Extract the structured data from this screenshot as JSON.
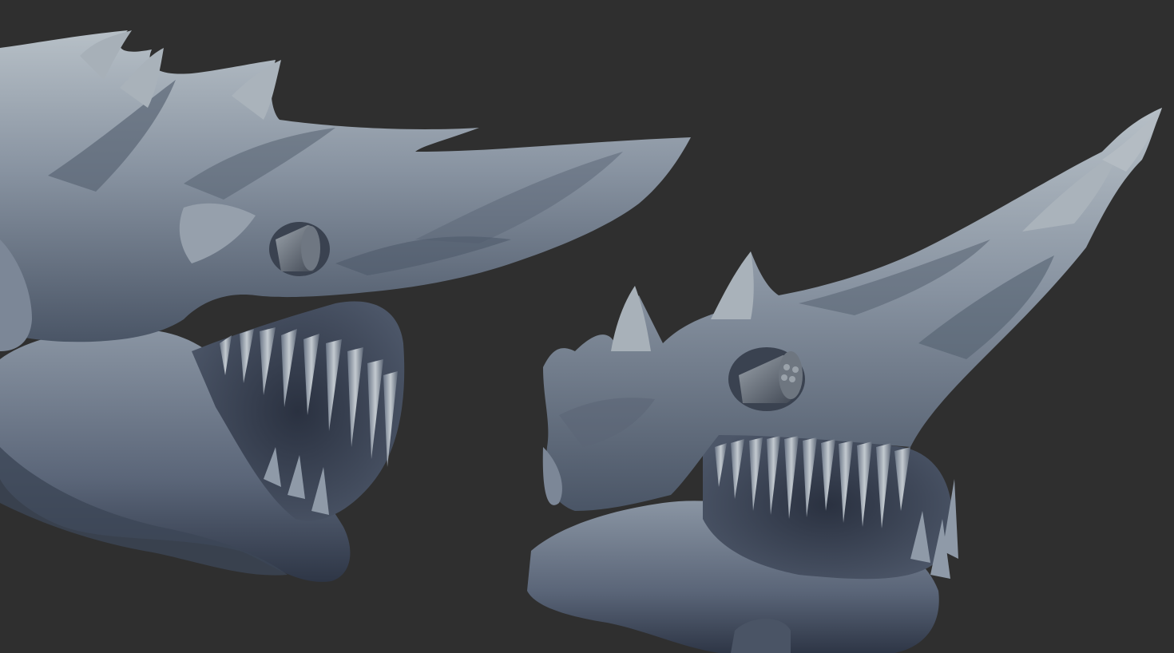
{
  "scene": {
    "background_color": "#2f2f2f",
    "material_color": "#8a96a6",
    "shadow_color": "#3c4656",
    "highlight_color": "#c9d0d4",
    "views": [
      {
        "id": "left",
        "subject": "dragon-skull-sculpt"
      },
      {
        "id": "right",
        "subject": "dragon-skull-sculpt"
      }
    ]
  }
}
